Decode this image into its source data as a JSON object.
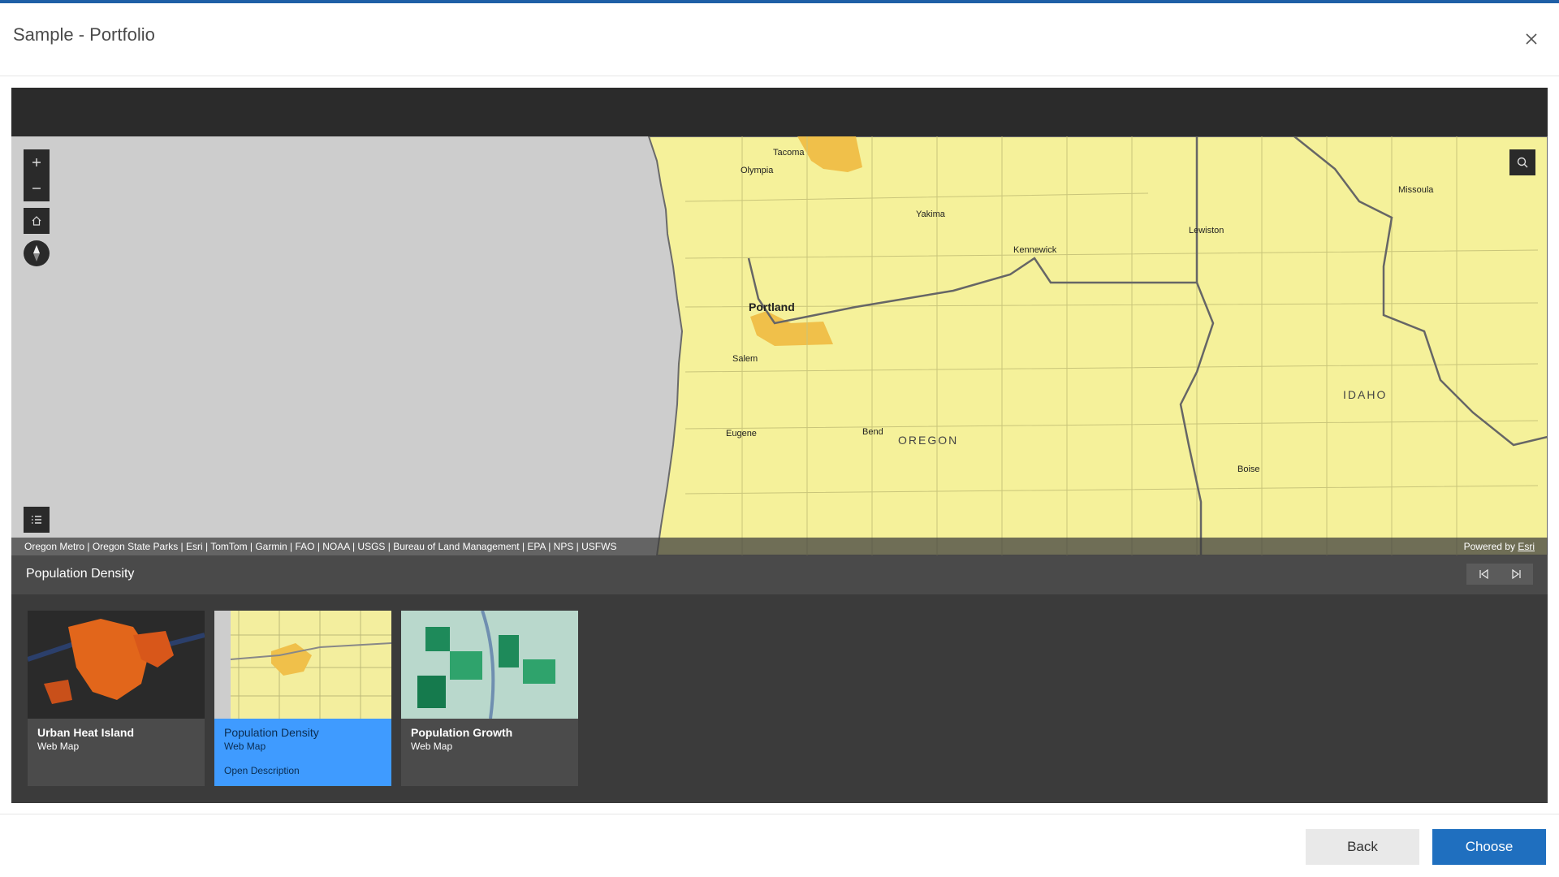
{
  "dialog": {
    "title": "Sample - Portfolio",
    "close_icon": "close-icon"
  },
  "map": {
    "labels": {
      "tacoma": "Tacoma",
      "olympia": "Olympia",
      "yakima": "Yakima",
      "kennewick": "Kennewick",
      "lewiston": "Lewiston",
      "missoula": "Missoula",
      "portland": "Portland",
      "salem": "Salem",
      "eugene": "Eugene",
      "bend": "Bend",
      "oregon": "OREGON",
      "idaho": "IDAHO",
      "boise": "Boise"
    },
    "attribution": "Oregon Metro | Oregon State Parks | Esri | TomTom | Garmin | FAO | NOAA | USGS | Bureau of Land Management | EPA | NPS | USFWS",
    "powered_by": "Powered by",
    "esri_link": "Esri",
    "colors": {
      "land": "#f5f19a",
      "water": "#cdcdcd",
      "highlight": "#f0c04a"
    }
  },
  "viewer": {
    "current_title": "Population Density",
    "items": [
      {
        "name": "Urban Heat Island",
        "type": "Web Map"
      },
      {
        "name": "Population Density",
        "type": "Web Map",
        "action": "Open Description"
      },
      {
        "name": "Population Growth",
        "type": "Web Map"
      }
    ]
  },
  "footer": {
    "back_label": "Back",
    "choose_label": "Choose"
  },
  "colors": {
    "accent": "#3f9bff",
    "primary": "#1f6fbf",
    "topbar": "#1f5fa6"
  }
}
